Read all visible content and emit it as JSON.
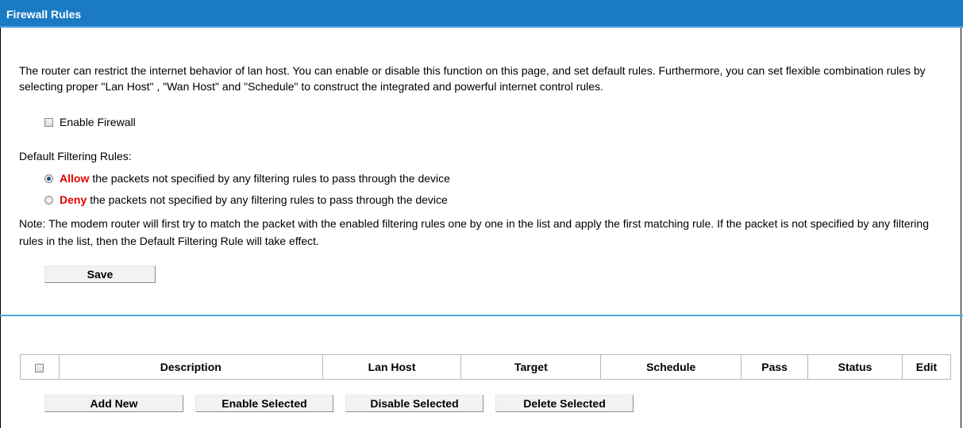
{
  "header": {
    "title": "Firewall Rules"
  },
  "intro": "The router can restrict the internet behavior of lan host. You can enable or disable this function on this page, and set default rules. Furthermore, you can set flexible combination rules by selecting proper \"Lan Host\" , \"Wan Host\" and \"Schedule\" to construct the integrated and powerful internet control rules.",
  "enable_firewall": {
    "label": "Enable Firewall",
    "checked": false
  },
  "default_rules": {
    "heading": "Default Filtering Rules:",
    "allow": {
      "keyword": "Allow",
      "text": "the packets not specified by any filtering rules to pass through the device",
      "checked": true
    },
    "deny": {
      "keyword": "Deny",
      "text": "the packets not specified by any filtering rules to pass through the device",
      "checked": false
    }
  },
  "note": "Note: The modem router will first try to match the packet with the enabled filtering rules one by one in the list and apply the first matching rule. If the packet is not specified by any filtering rules in the list, then the Default Filtering Rule will take effect.",
  "save_label": "Save",
  "table": {
    "columns": [
      "Description",
      "Lan Host",
      "Target",
      "Schedule",
      "Pass",
      "Status",
      "Edit"
    ]
  },
  "actions": {
    "add_new": "Add New",
    "enable_selected": "Enable Selected",
    "disable_selected": "Disable Selected",
    "delete_selected": "Delete Selected"
  },
  "colors": {
    "title_bar": "#1a7bc4",
    "divider": "#4da8de",
    "keyword_red": "#e00000"
  }
}
